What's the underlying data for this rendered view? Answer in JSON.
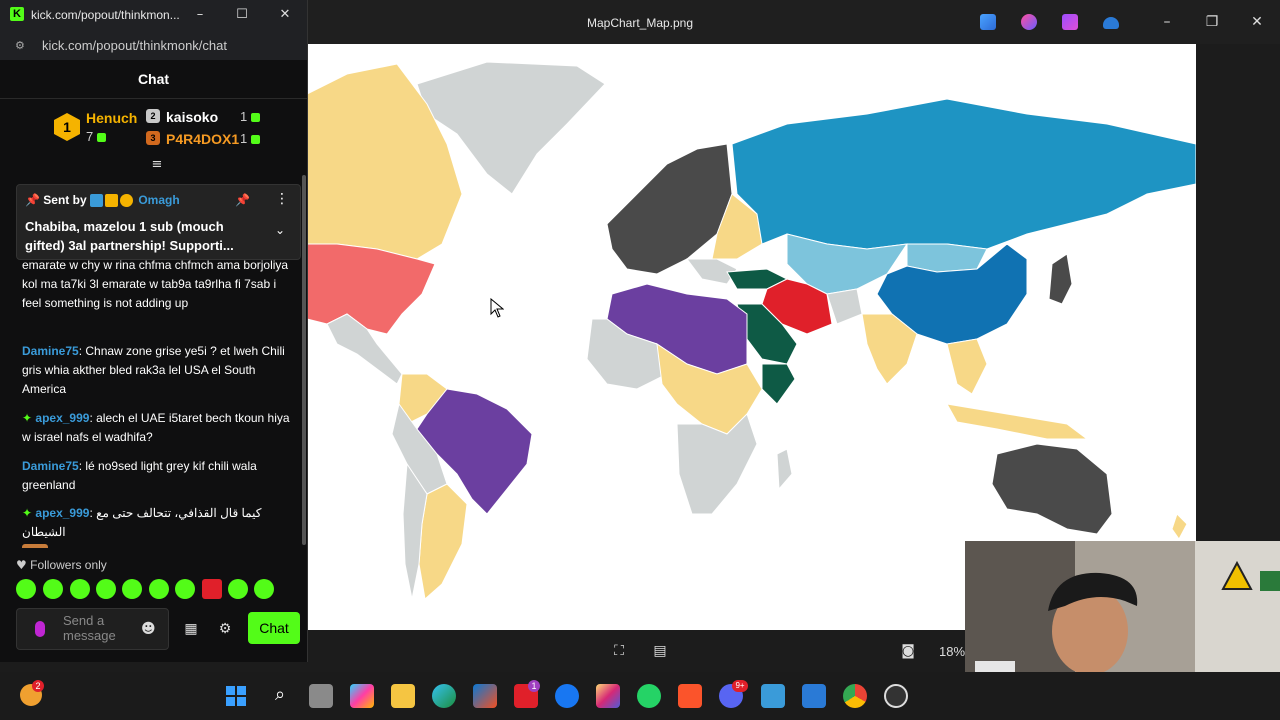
{
  "viewer": {
    "title": "MapChart_Map.png",
    "zoom": "18%",
    "icons": [
      "crop-icon",
      "edit-image-icon",
      "screenshot-icon"
    ],
    "colors": {
      "russia_blue": "#1e94c3",
      "light_blue": "#7dc4dc",
      "china_blue": "#1072b2",
      "purple": "#6b3fa0",
      "yellow": "#f7d887",
      "gray": "#d0d4d4",
      "dark_gray": "#4a4a4a",
      "red": "#e0202a",
      "dark_green": "#0e5a45",
      "usa_red": "#f26a6a"
    }
  },
  "kick": {
    "window_title": "kick.com/popout/thinkmon...",
    "url": "kick.com/popout/thinkmonk/chat",
    "chat_title": "Chat",
    "leaderboard": {
      "first": {
        "rank": "1",
        "name": "Henuch",
        "count": "7"
      },
      "second": {
        "rank": "2",
        "name": "kaisoko",
        "count": "1"
      },
      "third": {
        "rank": "3",
        "name": "P4R4DOX1",
        "count": "1"
      }
    },
    "pinned": {
      "sent_by_label": "Sent by",
      "author": "Omagh",
      "text": "Chabiba, mazelou 1 sub (mouch gifted) 3al partnership! Supporti..."
    },
    "messages": [
      {
        "user": "",
        "text": "emarate w chy w rina chfma chfmch ama borjoliya kol ma ta7ki 3l emarate w tab9a ta9rlha fi 7sab i feel something is not adding up"
      },
      {
        "user": "Damine75",
        "text": ": Chnaw zone grise ye5i ? et lweh Chili gris whia akther bled rak3a lel USA el South America"
      },
      {
        "user": "apex_999",
        "text": ": alech el UAE i5taret bech tkoun hiya w israel nafs el wadhifa?"
      },
      {
        "user": "Damine75",
        "text": ": lé no9sed light grey kif chili wala greenland"
      },
      {
        "user": "apex_999",
        "text": ": كيما قال القذافي، تتحالف حتى مع الشيطان"
      }
    ],
    "followers_only": "Followers only",
    "input_placeholder": "Send a message",
    "send_label": "Chat"
  },
  "taskbar": {
    "icons": [
      "weather-icon",
      "start-icon",
      "search-icon",
      "task-view-icon",
      "copilot-icon",
      "file-explorer-icon",
      "edge-icon",
      "store-icon",
      "lexique-icon",
      "facebook-icon",
      "instagram-icon",
      "whatsapp-icon",
      "brave-icon",
      "discord-icon",
      "photos-icon",
      "paint-icon",
      "chrome-icon",
      "obs-icon"
    ],
    "badges": {
      "weather": "2",
      "lexique": "1",
      "discord": "9+"
    }
  }
}
